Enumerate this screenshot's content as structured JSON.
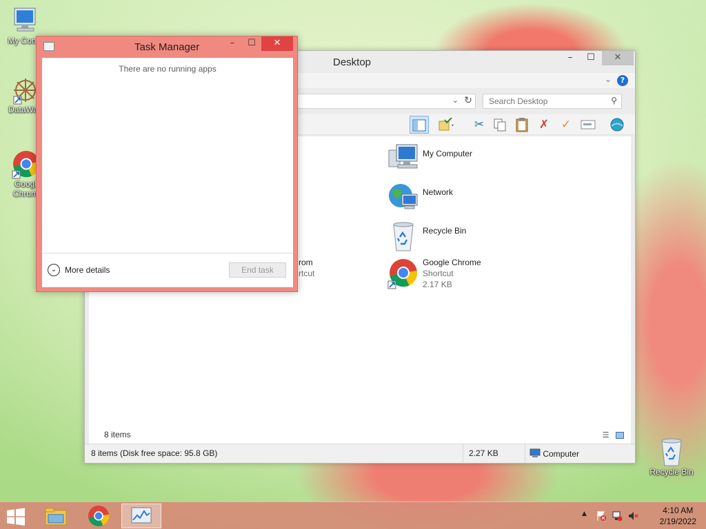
{
  "desktop": {
    "icons": [
      {
        "label": "My Comp",
        "icon": "computer-icon"
      },
      {
        "label": "DataWag",
        "icon": "datawag-icon"
      },
      {
        "label": "Googl Chrom",
        "label_line1": "Googl",
        "label_line2": "Chrom",
        "icon": "chrome-icon"
      },
      {
        "label": "Recycle Bin",
        "icon": "recycle-bin-icon"
      }
    ]
  },
  "explorer": {
    "title": "Desktop",
    "search_placeholder": "Search Desktop",
    "items": [
      {
        "name": "My Computer",
        "icon": "computer-icon"
      },
      {
        "name": "Network",
        "icon": "network-icon"
      },
      {
        "name": "Recycle Bin",
        "icon": "recycle-bin-icon"
      },
      {
        "name": "Google Chrome",
        "type": "Shortcut",
        "size": "2.17 KB",
        "icon": "chrome-icon"
      }
    ],
    "partial_item": {
      "name_fragment": "rom",
      "type_fragment": "rtcut"
    },
    "item_count": "8 items",
    "status": {
      "summary": "8 items (Disk free space: 95.8 GB)",
      "size": "2.27 KB",
      "location": "Computer"
    },
    "window_buttons": {
      "minimize": "–",
      "maximize": "☐",
      "close": "✕"
    }
  },
  "task_manager": {
    "title": "Task Manager",
    "empty_message": "There are no running apps",
    "more_details": "More details",
    "end_task": "End task",
    "window_buttons": {
      "minimize": "–",
      "maximize": "☐",
      "close": "✕"
    }
  },
  "taskbar": {
    "pinned": [
      {
        "name": "File Explorer",
        "icon": "file-explorer-icon"
      },
      {
        "name": "Google Chrome",
        "icon": "chrome-icon"
      },
      {
        "name": "Task Manager",
        "icon": "task-manager-icon",
        "active": true
      }
    ],
    "clock": {
      "time": "4:10 AM",
      "date": "2/19/2022"
    }
  },
  "colors": {
    "taskmgr_frame": "#f08a80",
    "close_red": "#e04343",
    "taskbar": "#d68c78",
    "accent_blue": "#1f6fd1"
  }
}
